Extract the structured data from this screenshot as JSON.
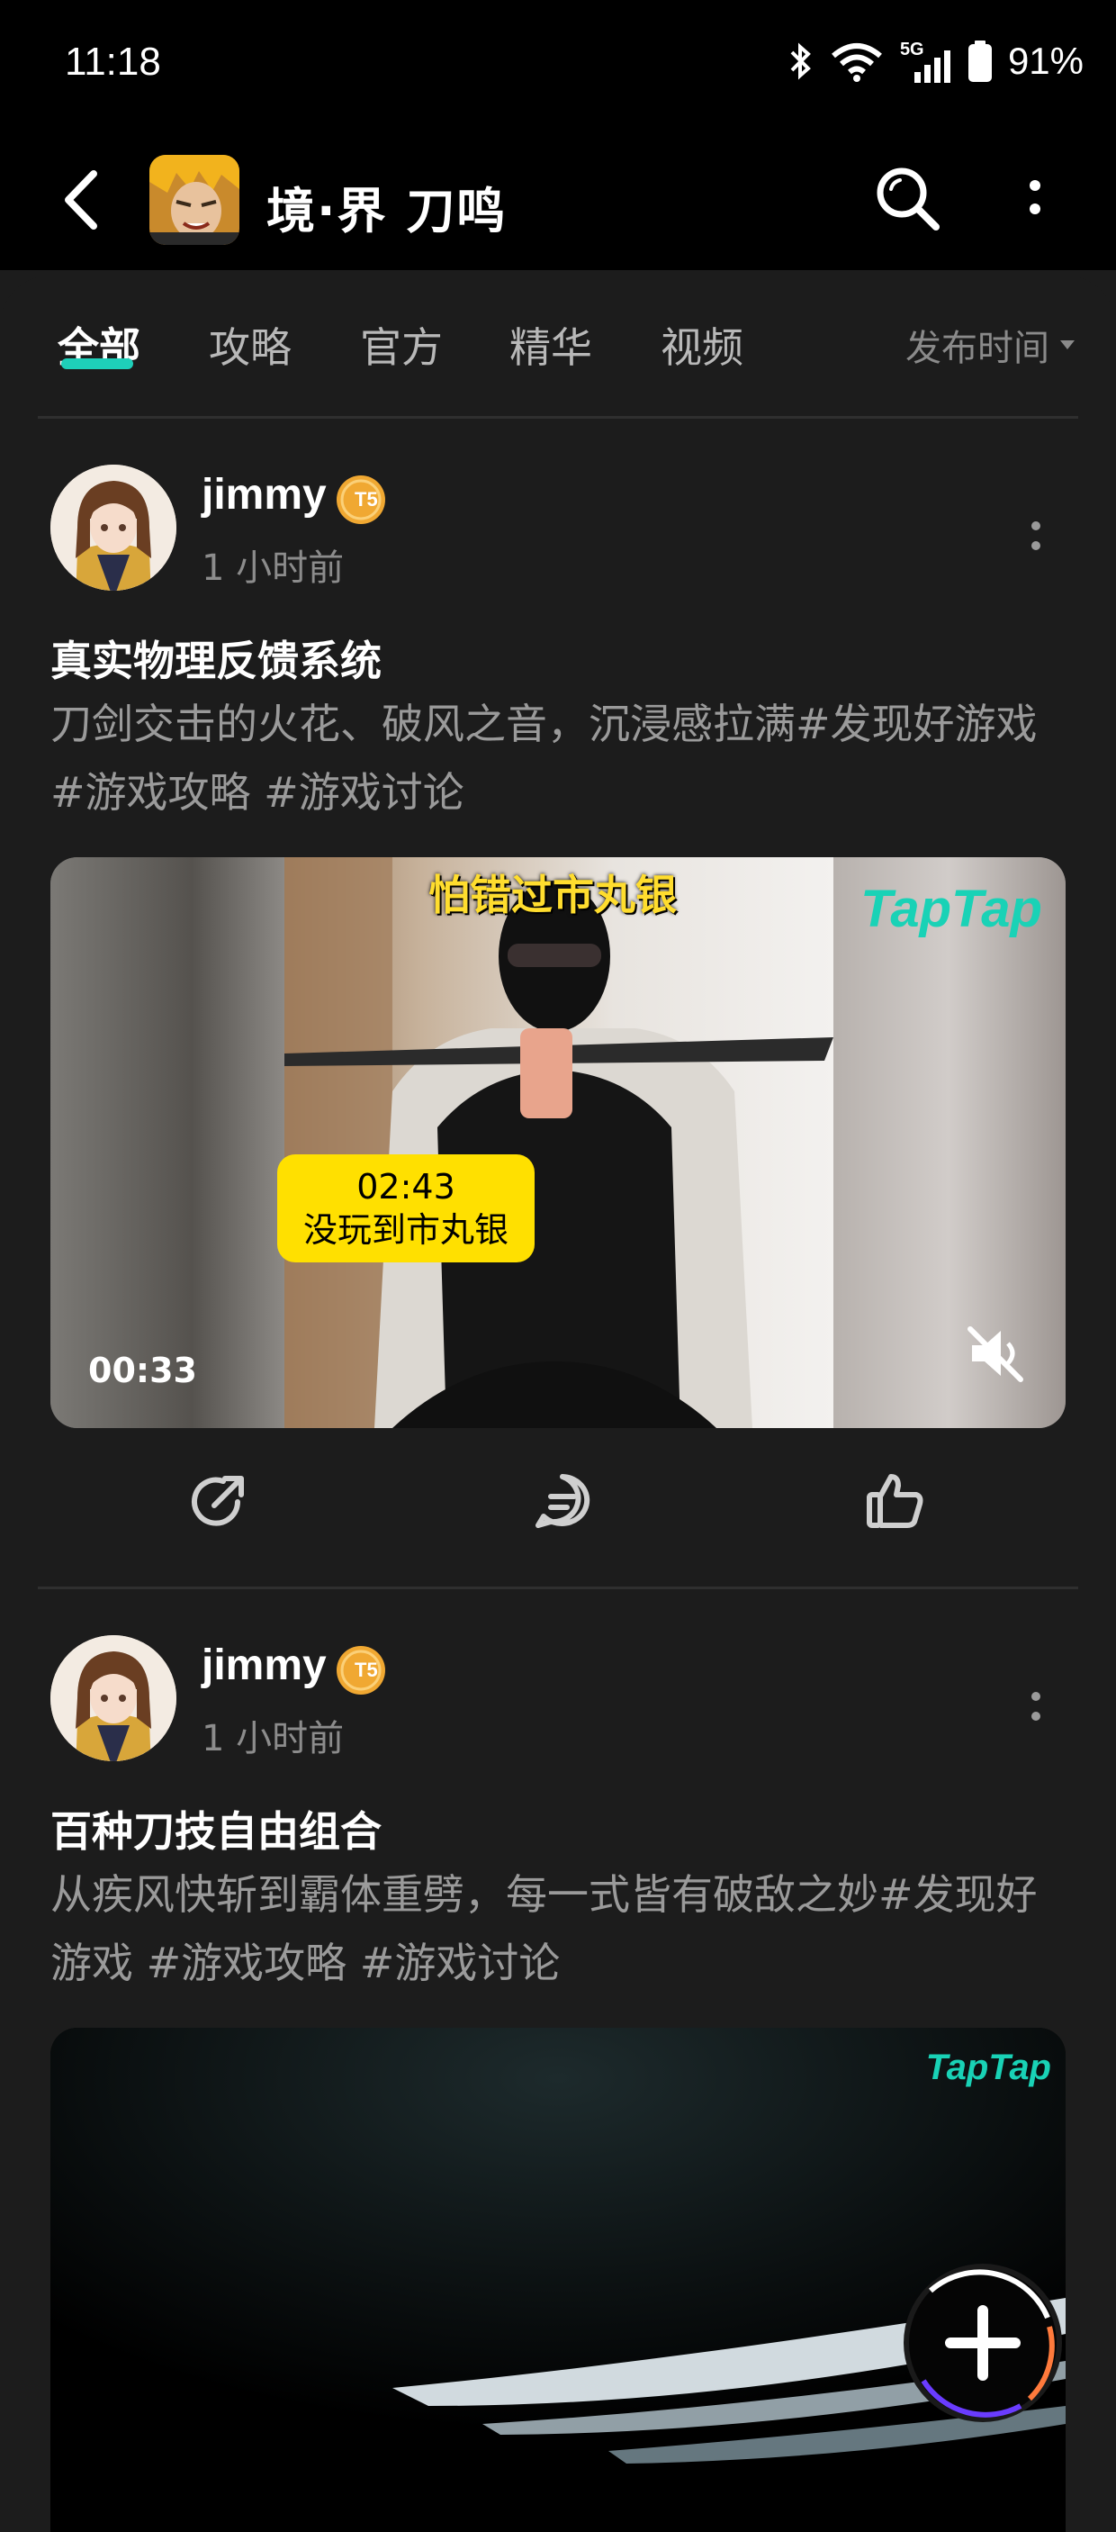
{
  "status_bar": {
    "time": "11:18",
    "network": "5G",
    "battery": "91%"
  },
  "header": {
    "game_title": "境·界 刀鸣"
  },
  "tabs": [
    {
      "label": "全部",
      "active": true
    },
    {
      "label": "攻略",
      "active": false
    },
    {
      "label": "官方",
      "active": false
    },
    {
      "label": "精华",
      "active": false
    },
    {
      "label": "视频",
      "active": false
    }
  ],
  "sort": {
    "label": "发布时间"
  },
  "posts": [
    {
      "username": "jimmy",
      "badge": "T5",
      "time": "1 小时前",
      "title": "真实物理反馈系统",
      "body": "刀剑交击的火花、破风之音，沉浸感拉满#发现好游戏 #游戏攻略 #游戏讨论",
      "video": {
        "caption_top": "怕错过市丸银",
        "watermark": "TapTap",
        "badge_time": "02:43",
        "badge_text": "没玩到市丸银",
        "duration": "00:33",
        "muted": true
      }
    },
    {
      "username": "jimmy",
      "badge": "T5",
      "time": "1 小时前",
      "title": "百种刀技自由组合",
      "body": "从疾风快斩到霸体重劈，每一式皆有破敌之妙#发现好游戏 #游戏攻略 #游戏讨论",
      "video": {
        "watermark": "TapTap"
      }
    }
  ],
  "colors": {
    "accent": "#1ecfb9",
    "badge_gold": "#f0a832",
    "highlight_yellow": "#ffe000"
  }
}
